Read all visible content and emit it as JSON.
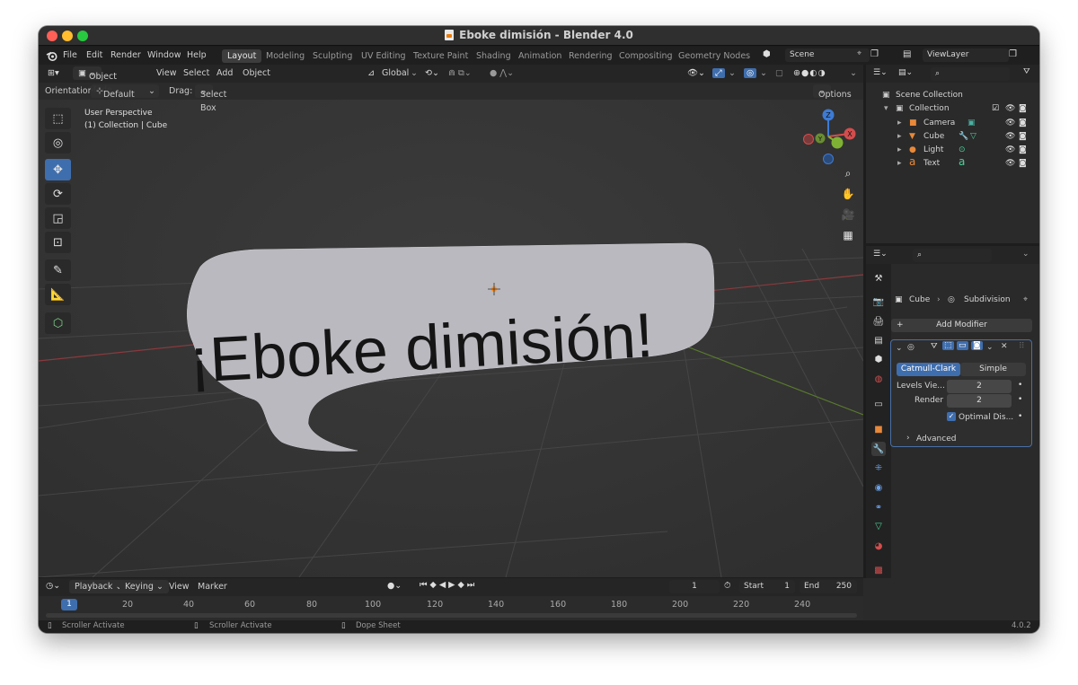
{
  "window": {
    "title": "Eboke dimisión - Blender 4.0"
  },
  "menu": [
    "File",
    "Edit",
    "Render",
    "Window",
    "Help"
  ],
  "workspaces": [
    "Layout",
    "Modeling",
    "Sculpting",
    "UV Editing",
    "Texture Paint",
    "Shading",
    "Animation",
    "Rendering",
    "Compositing",
    "Geometry Nodes"
  ],
  "scene": {
    "name": "Scene",
    "view_layer": "ViewLayer"
  },
  "viewport": {
    "mode": "Object Mode",
    "menus": [
      "View",
      "Select",
      "Add",
      "Object"
    ],
    "transform": "Global",
    "orientation_label": "Orientation:",
    "orientation_value": "Default",
    "drag_label": "Drag:",
    "drag_value": "Select Box",
    "options": "Options",
    "info_line1": "User Perspective",
    "info_line2": "(1) Collection | Cube",
    "bubble_text": "¡Eboke dimisión!",
    "gizmo": {
      "z": "Z",
      "y": "Y",
      "x": "X"
    }
  },
  "outliner": {
    "root": "Scene Collection",
    "collection": "Collection",
    "items": [
      "Camera",
      "Cube",
      "Light",
      "Text"
    ]
  },
  "properties": {
    "breadcrumb_object": "Cube",
    "breadcrumb_modifier": "Subdivision",
    "add_modifier": "Add Modifier",
    "tab_catmull": "Catmull-Clark",
    "tab_simple": "Simple",
    "levels_label": "Levels Vie...",
    "levels_value": "2",
    "render_label": "Render",
    "render_value": "2",
    "optimal": "Optimal Dis...",
    "advanced": "Advanced"
  },
  "timeline": {
    "menus": [
      "Playback",
      "Keying",
      "View",
      "Marker"
    ],
    "current_frame": "1",
    "start_label": "Start",
    "start_value": "1",
    "end_label": "End",
    "end_value": "250",
    "ticks": [
      "1",
      "20",
      "40",
      "60",
      "80",
      "100",
      "120",
      "140",
      "160",
      "180",
      "200",
      "220",
      "240"
    ]
  },
  "statusbar": {
    "item1": "Scroller Activate",
    "item2": "Scroller Activate",
    "item3": "Dope Sheet",
    "version": "4.0.2"
  }
}
